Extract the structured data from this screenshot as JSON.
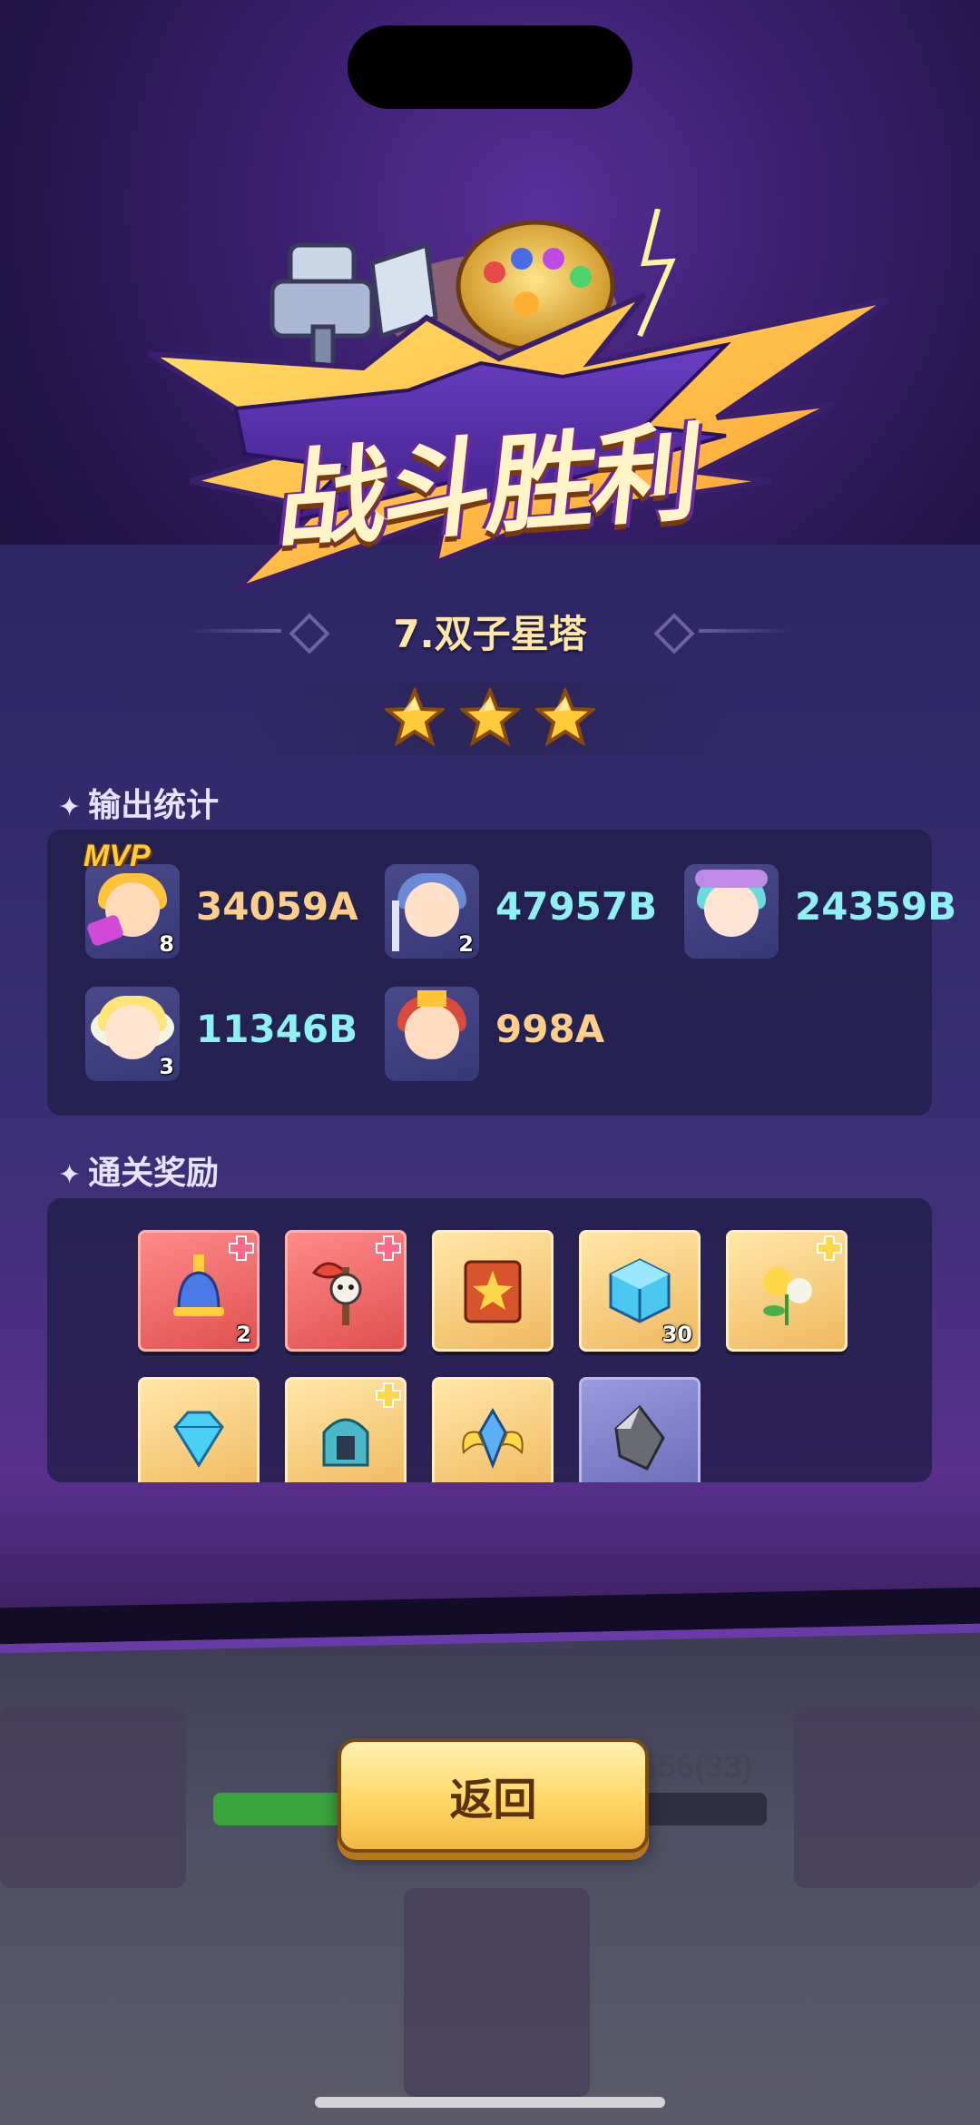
{
  "victory": {
    "title": "战斗胜利"
  },
  "level": {
    "title": "7.双子星塔"
  },
  "rating": {
    "stars_earned": 3,
    "stars_total": 3
  },
  "output_stats": {
    "label": "输出统计",
    "heroes": [
      {
        "damage": "34059A",
        "level": "8",
        "mvp": "MVP",
        "color": "#ffcf8a"
      },
      {
        "damage": "47957B",
        "level": "2",
        "color": "#8ef0f0"
      },
      {
        "damage": "24359B",
        "level": "",
        "color": "#8ef0f0"
      },
      {
        "damage": "11346B",
        "level": "3",
        "color": "#8ef0f0"
      },
      {
        "damage": "998A",
        "level": "",
        "color": "#ffcf8a"
      }
    ]
  },
  "rewards": {
    "label": "通关奖励",
    "items": [
      {
        "icon": "bell-hero-fragment-icon",
        "qty": "2",
        "style": "red"
      },
      {
        "icon": "skull-axe-hero-fragment-icon",
        "qty": "",
        "style": "red"
      },
      {
        "icon": "spellbook-icon",
        "qty": "",
        "style": "gold"
      },
      {
        "icon": "blue-cube-icon",
        "qty": "30",
        "style": "gold"
      },
      {
        "icon": "flower-fragment-icon",
        "qty": "",
        "style": "gold"
      },
      {
        "icon": "diamond-icon",
        "qty": "",
        "style": "gold"
      },
      {
        "icon": "helmet-fragment-icon",
        "qty": "",
        "style": "gold"
      },
      {
        "icon": "winged-crest-icon",
        "qty": "",
        "style": "gold"
      },
      {
        "icon": "grey-crystal-icon",
        "qty": "",
        "style": "purple"
      }
    ]
  },
  "background_scene": {
    "text": "556(33)"
  },
  "back_button": {
    "label": "返回"
  }
}
